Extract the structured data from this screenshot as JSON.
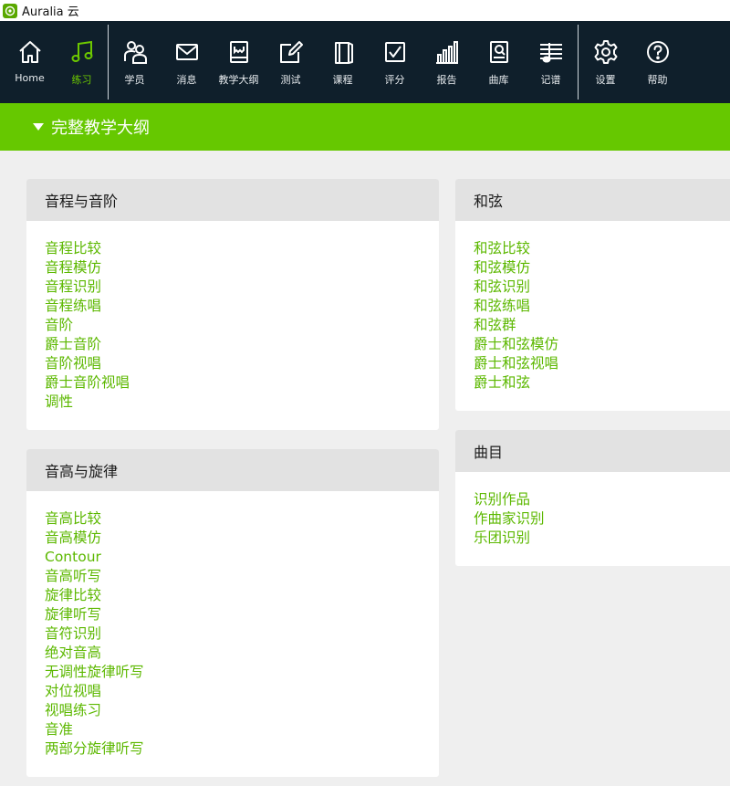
{
  "window": {
    "title": "Auralia 云"
  },
  "toolbar": {
    "items": [
      {
        "id": "home",
        "label": "Home",
        "icon": "home-icon"
      },
      {
        "id": "practice",
        "label": "练习",
        "icon": "music-note-icon"
      },
      {
        "id": "students",
        "label": "学员",
        "icon": "users-icon"
      },
      {
        "id": "messages",
        "label": "消息",
        "icon": "mail-icon"
      },
      {
        "id": "syllabus",
        "label": "教学大纲",
        "icon": "book-icon"
      },
      {
        "id": "tests",
        "label": "测试",
        "icon": "pencil-icon"
      },
      {
        "id": "courses",
        "label": "课程",
        "icon": "notebook-icon"
      },
      {
        "id": "grading",
        "label": "评分",
        "icon": "checkbox-icon"
      },
      {
        "id": "reports",
        "label": "报告",
        "icon": "bar-chart-icon"
      },
      {
        "id": "library",
        "label": "曲库",
        "icon": "score-book-icon"
      },
      {
        "id": "notation",
        "label": "记谱",
        "icon": "staff-icon"
      },
      {
        "id": "settings",
        "label": "设置",
        "icon": "gear-icon"
      },
      {
        "id": "help",
        "label": "帮助",
        "icon": "help-icon"
      }
    ],
    "active": "练习",
    "accent_color": "#6dc800"
  },
  "section": {
    "title": "完整教学大纲"
  },
  "cards": {
    "intervals": {
      "title": "音程与音阶",
      "items": [
        "音程比较",
        "音程模仿",
        "音程识别",
        "音程练唱",
        "音阶",
        "爵士音阶",
        "音阶视唱",
        "爵士音阶视唱",
        "调性"
      ]
    },
    "pitch": {
      "title": "音高与旋律",
      "items": [
        "音高比较",
        "音高模仿",
        "Contour",
        "音高听写",
        "旋律比较",
        "旋律听写",
        "音符识别",
        "绝对音高",
        "无调性旋律听写",
        "对位视唱",
        "视唱练习",
        "音准",
        "两部分旋律听写"
      ]
    },
    "chords": {
      "title": "和弦",
      "items": [
        "和弦比较",
        "和弦模仿",
        "和弦识别",
        "和弦练唱",
        "和弦群",
        "爵士和弦模仿",
        "爵士和弦视唱",
        "爵士和弦"
      ]
    },
    "repertoire": {
      "title": "曲目",
      "items": [
        "识别作品",
        "作曲家识别",
        "乐团识别"
      ]
    }
  },
  "colors": {
    "header_green": "#66c800",
    "link_green": "#5cb800",
    "toolbar_bg": "#0f1f2b",
    "page_bg": "#efefef"
  }
}
